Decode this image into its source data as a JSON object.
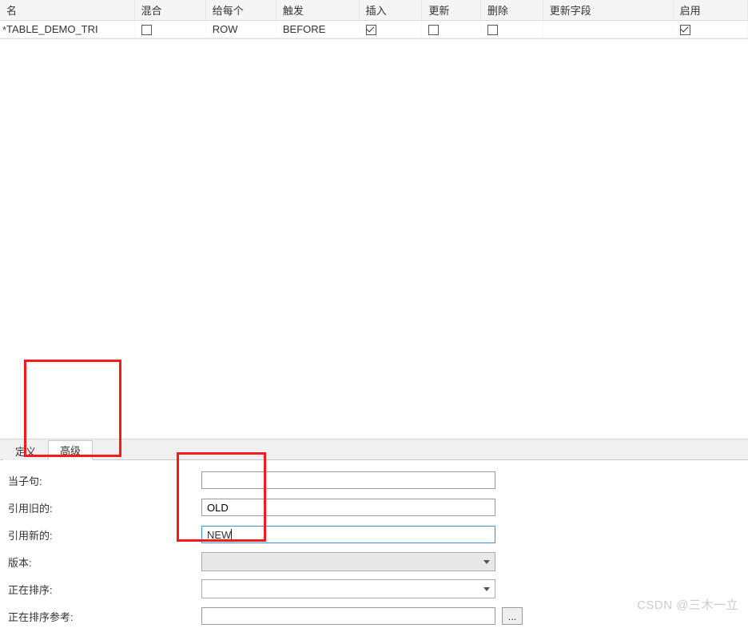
{
  "table": {
    "headers": {
      "name": "名",
      "mix": "混合",
      "each": "给每个",
      "trigger": "触发",
      "insert": "插入",
      "update": "更新",
      "delete": "删除",
      "update_fields": "更新字段",
      "enable": "启用"
    },
    "row": {
      "modified_mark": "*",
      "name": "TABLE_DEMO_TRI",
      "mix_checked": false,
      "each": "ROW",
      "trigger": "BEFORE",
      "insert_checked": true,
      "update_checked": false,
      "delete_checked": false,
      "update_fields": "",
      "enable_checked": true
    }
  },
  "tabs": {
    "define": "定义",
    "advanced": "高级",
    "active": "advanced"
  },
  "form": {
    "when_clause": {
      "label": "当子句:",
      "value": ""
    },
    "ref_old": {
      "label": "引用旧的:",
      "value": "OLD"
    },
    "ref_new": {
      "label": "引用新的:",
      "value": "NEW"
    },
    "version": {
      "label": "版本:",
      "value": ""
    },
    "sorting": {
      "label": "正在排序:",
      "value": ""
    },
    "sorting_ref": {
      "label": "正在排序参考:",
      "value": ""
    }
  },
  "browse_btn": "...",
  "watermark": "CSDN @三木一立"
}
